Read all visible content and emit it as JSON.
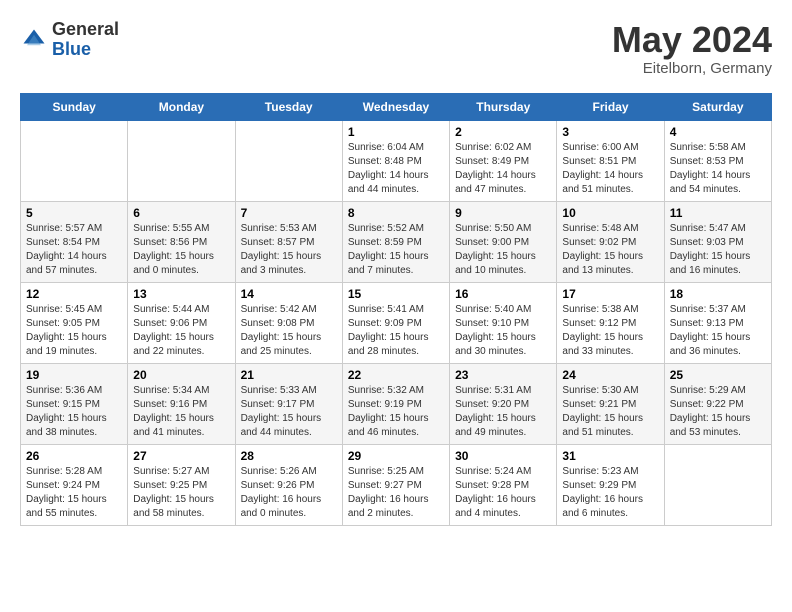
{
  "header": {
    "logo_line1": "General",
    "logo_line2": "Blue",
    "month_title": "May 2024",
    "location": "Eitelborn, Germany"
  },
  "calendar": {
    "days_of_week": [
      "Sunday",
      "Monday",
      "Tuesday",
      "Wednesday",
      "Thursday",
      "Friday",
      "Saturday"
    ],
    "weeks": [
      [
        {
          "day": "",
          "info": ""
        },
        {
          "day": "",
          "info": ""
        },
        {
          "day": "",
          "info": ""
        },
        {
          "day": "1",
          "info": "Sunrise: 6:04 AM\nSunset: 8:48 PM\nDaylight: 14 hours\nand 44 minutes."
        },
        {
          "day": "2",
          "info": "Sunrise: 6:02 AM\nSunset: 8:49 PM\nDaylight: 14 hours\nand 47 minutes."
        },
        {
          "day": "3",
          "info": "Sunrise: 6:00 AM\nSunset: 8:51 PM\nDaylight: 14 hours\nand 51 minutes."
        },
        {
          "day": "4",
          "info": "Sunrise: 5:58 AM\nSunset: 8:53 PM\nDaylight: 14 hours\nand 54 minutes."
        }
      ],
      [
        {
          "day": "5",
          "info": "Sunrise: 5:57 AM\nSunset: 8:54 PM\nDaylight: 14 hours\nand 57 minutes."
        },
        {
          "day": "6",
          "info": "Sunrise: 5:55 AM\nSunset: 8:56 PM\nDaylight: 15 hours\nand 0 minutes."
        },
        {
          "day": "7",
          "info": "Sunrise: 5:53 AM\nSunset: 8:57 PM\nDaylight: 15 hours\nand 3 minutes."
        },
        {
          "day": "8",
          "info": "Sunrise: 5:52 AM\nSunset: 8:59 PM\nDaylight: 15 hours\nand 7 minutes."
        },
        {
          "day": "9",
          "info": "Sunrise: 5:50 AM\nSunset: 9:00 PM\nDaylight: 15 hours\nand 10 minutes."
        },
        {
          "day": "10",
          "info": "Sunrise: 5:48 AM\nSunset: 9:02 PM\nDaylight: 15 hours\nand 13 minutes."
        },
        {
          "day": "11",
          "info": "Sunrise: 5:47 AM\nSunset: 9:03 PM\nDaylight: 15 hours\nand 16 minutes."
        }
      ],
      [
        {
          "day": "12",
          "info": "Sunrise: 5:45 AM\nSunset: 9:05 PM\nDaylight: 15 hours\nand 19 minutes."
        },
        {
          "day": "13",
          "info": "Sunrise: 5:44 AM\nSunset: 9:06 PM\nDaylight: 15 hours\nand 22 minutes."
        },
        {
          "day": "14",
          "info": "Sunrise: 5:42 AM\nSunset: 9:08 PM\nDaylight: 15 hours\nand 25 minutes."
        },
        {
          "day": "15",
          "info": "Sunrise: 5:41 AM\nSunset: 9:09 PM\nDaylight: 15 hours\nand 28 minutes."
        },
        {
          "day": "16",
          "info": "Sunrise: 5:40 AM\nSunset: 9:10 PM\nDaylight: 15 hours\nand 30 minutes."
        },
        {
          "day": "17",
          "info": "Sunrise: 5:38 AM\nSunset: 9:12 PM\nDaylight: 15 hours\nand 33 minutes."
        },
        {
          "day": "18",
          "info": "Sunrise: 5:37 AM\nSunset: 9:13 PM\nDaylight: 15 hours\nand 36 minutes."
        }
      ],
      [
        {
          "day": "19",
          "info": "Sunrise: 5:36 AM\nSunset: 9:15 PM\nDaylight: 15 hours\nand 38 minutes."
        },
        {
          "day": "20",
          "info": "Sunrise: 5:34 AM\nSunset: 9:16 PM\nDaylight: 15 hours\nand 41 minutes."
        },
        {
          "day": "21",
          "info": "Sunrise: 5:33 AM\nSunset: 9:17 PM\nDaylight: 15 hours\nand 44 minutes."
        },
        {
          "day": "22",
          "info": "Sunrise: 5:32 AM\nSunset: 9:19 PM\nDaylight: 15 hours\nand 46 minutes."
        },
        {
          "day": "23",
          "info": "Sunrise: 5:31 AM\nSunset: 9:20 PM\nDaylight: 15 hours\nand 49 minutes."
        },
        {
          "day": "24",
          "info": "Sunrise: 5:30 AM\nSunset: 9:21 PM\nDaylight: 15 hours\nand 51 minutes."
        },
        {
          "day": "25",
          "info": "Sunrise: 5:29 AM\nSunset: 9:22 PM\nDaylight: 15 hours\nand 53 minutes."
        }
      ],
      [
        {
          "day": "26",
          "info": "Sunrise: 5:28 AM\nSunset: 9:24 PM\nDaylight: 15 hours\nand 55 minutes."
        },
        {
          "day": "27",
          "info": "Sunrise: 5:27 AM\nSunset: 9:25 PM\nDaylight: 15 hours\nand 58 minutes."
        },
        {
          "day": "28",
          "info": "Sunrise: 5:26 AM\nSunset: 9:26 PM\nDaylight: 16 hours\nand 0 minutes."
        },
        {
          "day": "29",
          "info": "Sunrise: 5:25 AM\nSunset: 9:27 PM\nDaylight: 16 hours\nand 2 minutes."
        },
        {
          "day": "30",
          "info": "Sunrise: 5:24 AM\nSunset: 9:28 PM\nDaylight: 16 hours\nand 4 minutes."
        },
        {
          "day": "31",
          "info": "Sunrise: 5:23 AM\nSunset: 9:29 PM\nDaylight: 16 hours\nand 6 minutes."
        },
        {
          "day": "",
          "info": ""
        }
      ]
    ]
  }
}
